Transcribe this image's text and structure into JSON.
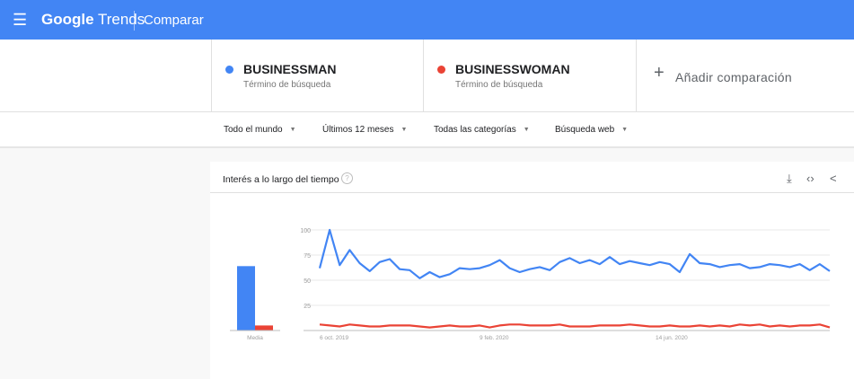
{
  "header": {
    "menu_icon": "hamburger-icon",
    "brand_bold": "Google",
    "brand_rest": " Trends",
    "compare": "Comparar"
  },
  "terms": [
    {
      "name": "BUSINESSMAN",
      "sub": "Término de búsqueda",
      "color": "#4285f4"
    },
    {
      "name": "BUSINESSWOMAN",
      "sub": "Término de búsqueda",
      "color": "#ea4335"
    }
  ],
  "add_comparison": {
    "label": "Añadir comparación",
    "icon": "plus-icon"
  },
  "filters": [
    "Todo el mundo",
    "Últimos 12 meses",
    "Todas las categorías",
    "Búsqueda web"
  ],
  "card": {
    "title": "Interés a lo largo del tiempo",
    "help": "?",
    "icons": [
      "download-icon",
      "embed-icon",
      "share-icon"
    ]
  },
  "chart_data": {
    "type": "line",
    "ylim": [
      0,
      100
    ],
    "y_ticks": [
      25,
      50,
      75,
      100
    ],
    "x_ticks": [
      "6 oct. 2019",
      "9 feb. 2020",
      "14 jun. 2020"
    ],
    "average_label": "Media",
    "averages": [
      64,
      5
    ],
    "series": [
      {
        "name": "BUSINESSMAN",
        "color": "#4285f4",
        "values": [
          62,
          100,
          65,
          80,
          67,
          59,
          68,
          71,
          61,
          60,
          52,
          58,
          53,
          56,
          62,
          61,
          62,
          65,
          70,
          62,
          58,
          61,
          63,
          60,
          68,
          72,
          67,
          70,
          66,
          73,
          66,
          69,
          67,
          65,
          68,
          66,
          58,
          76,
          67,
          66,
          63,
          65,
          66,
          62,
          63,
          66,
          65,
          63,
          66,
          60,
          66,
          59
        ]
      },
      {
        "name": "BUSINESSWOMAN",
        "color": "#ea4335",
        "values": [
          6,
          5,
          4,
          6,
          5,
          4,
          4,
          5,
          5,
          5,
          4,
          3,
          4,
          5,
          4,
          4,
          5,
          3,
          5,
          6,
          6,
          5,
          5,
          5,
          6,
          4,
          4,
          4,
          5,
          5,
          5,
          6,
          5,
          4,
          4,
          5,
          4,
          4,
          5,
          4,
          5,
          4,
          6,
          5,
          6,
          4,
          5,
          4,
          5,
          5,
          6,
          3
        ]
      }
    ]
  }
}
